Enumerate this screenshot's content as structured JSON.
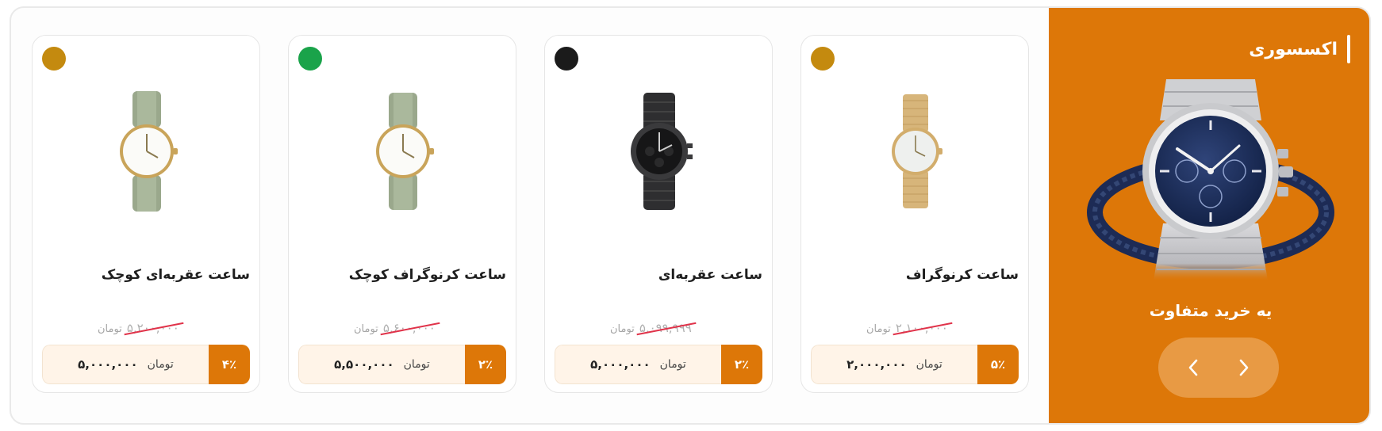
{
  "promo": {
    "title": "اکسسوری",
    "subtitle": "یه خرید متفاوت",
    "prev_icon": "chevron-left-icon",
    "next_icon": "chevron-right-icon",
    "background": "#dd7708"
  },
  "products": [
    {
      "title": "ساعت کرنوگراف",
      "old_price": "۲,۱۰۰,۰۰۰",
      "old_unit": "تومان",
      "price": "۲,۰۰۰,۰۰۰",
      "unit": "تومان",
      "discount": "۵٪",
      "dot_color": "#c48a0f"
    },
    {
      "title": "ساعت عقربه‌ای",
      "old_price": "۵,۰۹۹,۹۹۹",
      "old_unit": "تومان",
      "price": "۵,۰۰۰,۰۰۰",
      "unit": "تومان",
      "discount": "۲٪",
      "dot_color": "#1b1b1b"
    },
    {
      "title": "ساعت کرنوگراف کوچک",
      "old_price": "۵,۶۰۰,۰۰۰",
      "old_unit": "تومان",
      "price": "۵,۵۰۰,۰۰۰",
      "unit": "تومان",
      "discount": "۲٪",
      "dot_color": "#1aa34a"
    },
    {
      "title": "ساعت عقربه‌ای کوچک",
      "old_price": "۵,۲۰۰,۰۰۰",
      "old_unit": "تومان",
      "price": "۵,۰۰۰,۰۰۰",
      "unit": "تومان",
      "discount": "۴٪",
      "dot_color": "#c48a0f"
    }
  ]
}
